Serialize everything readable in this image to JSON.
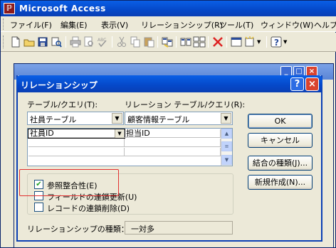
{
  "app": {
    "title": "Microsoft Access",
    "menu": [
      "ファイル(F)",
      "編集(E)",
      "表示(V)",
      "リレーションシップ(R)",
      "ツール(T)",
      "ウィンドウ(W)",
      "ヘルプ"
    ]
  },
  "dialog": {
    "title": "リレーションシップ",
    "help_label": "?",
    "close_label": "×",
    "table_label": "テーブル/クエリ(T):",
    "related_table_label": "リレーション テーブル/クエリ(R):",
    "table_value": "社員テーブル",
    "related_table_value": "顧客情報テーブル",
    "fields": [
      {
        "left": "社員ID",
        "right": "担当ID"
      }
    ],
    "buttons": {
      "ok": "OK",
      "cancel": "キャンセル",
      "join_type": "結合の種類(J)...",
      "create_new": "新規作成(N)..."
    },
    "checkboxes": [
      {
        "label": "参照整合性(E)",
        "checked": true
      },
      {
        "label": "フィールドの連鎖更新(U)",
        "checked": false
      },
      {
        "label": "レコードの連鎖削除(D)",
        "checked": false
      }
    ],
    "relationship_type_label": "リレーションシップの種類：",
    "relationship_type_value": "一対多"
  },
  "colors": {
    "titlebar": "#0548c8",
    "highlight_box": "#e23030"
  }
}
